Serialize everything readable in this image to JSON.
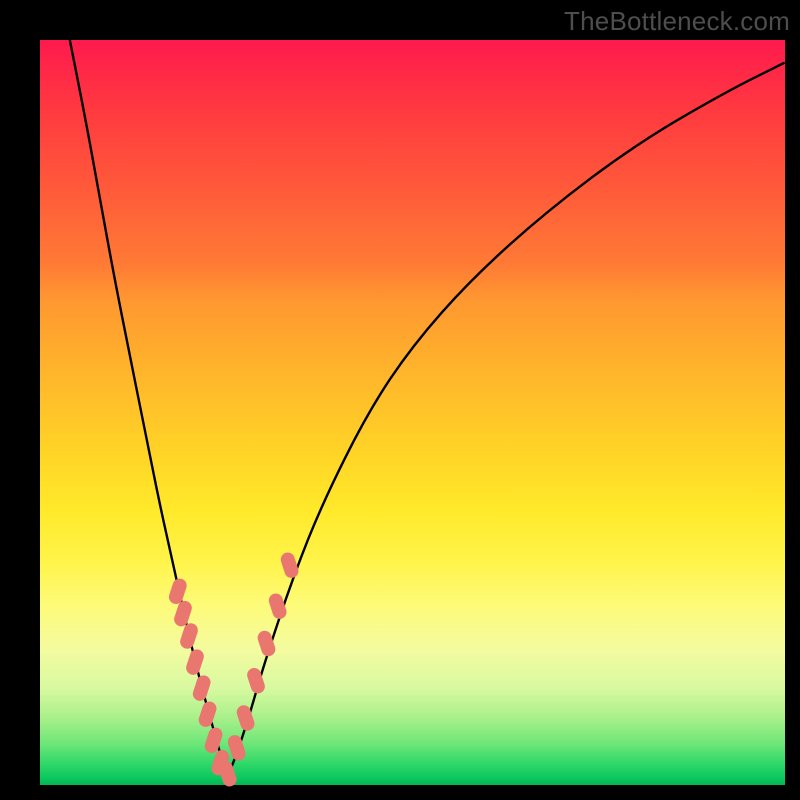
{
  "watermark_text": "TheBottleneck.com",
  "colors": {
    "frame": "#000000",
    "curve": "#000000",
    "marker_fill": "#e9776f",
    "gradient_top": "#ff1a4d",
    "gradient_bottom": "#04b556"
  },
  "chart_data": {
    "type": "line",
    "title": "",
    "xlabel": "",
    "ylabel": "",
    "xlim": [
      0,
      100
    ],
    "ylim": [
      0,
      100
    ],
    "note": "V-shaped bottleneck curve; y is mismatch percentage (0 at trough ≈ green, 100 at top ≈ red). x is relative component performance. Trough around x≈25. Values estimated from pixel positions; no axis ticks are shown.",
    "series": [
      {
        "name": "bottleneck-curve",
        "x": [
          4,
          6,
          8,
          10,
          12,
          14,
          16,
          18,
          20,
          22,
          24,
          25,
          26,
          28,
          30,
          34,
          38,
          44,
          50,
          58,
          68,
          80,
          92,
          100
        ],
        "y": [
          100,
          90,
          79,
          68,
          58,
          48,
          38,
          29,
          20,
          12,
          5,
          1,
          3,
          9,
          16,
          28,
          38,
          50,
          59,
          68,
          77,
          86,
          93,
          97
        ]
      }
    ],
    "markers": {
      "name": "highlighted-points",
      "note": "Pink rounded markers clustered near the trough on both branches.",
      "x": [
        18.5,
        19.2,
        20.0,
        20.8,
        21.7,
        22.5,
        23.3,
        24.2,
        25.2,
        26.4,
        27.6,
        29.0,
        30.4,
        31.9,
        33.5
      ],
      "y": [
        26.0,
        23.0,
        20.0,
        16.5,
        13.0,
        9.5,
        6.0,
        3.0,
        1.5,
        5.0,
        9.0,
        14.0,
        19.0,
        24.0,
        29.5
      ]
    }
  }
}
